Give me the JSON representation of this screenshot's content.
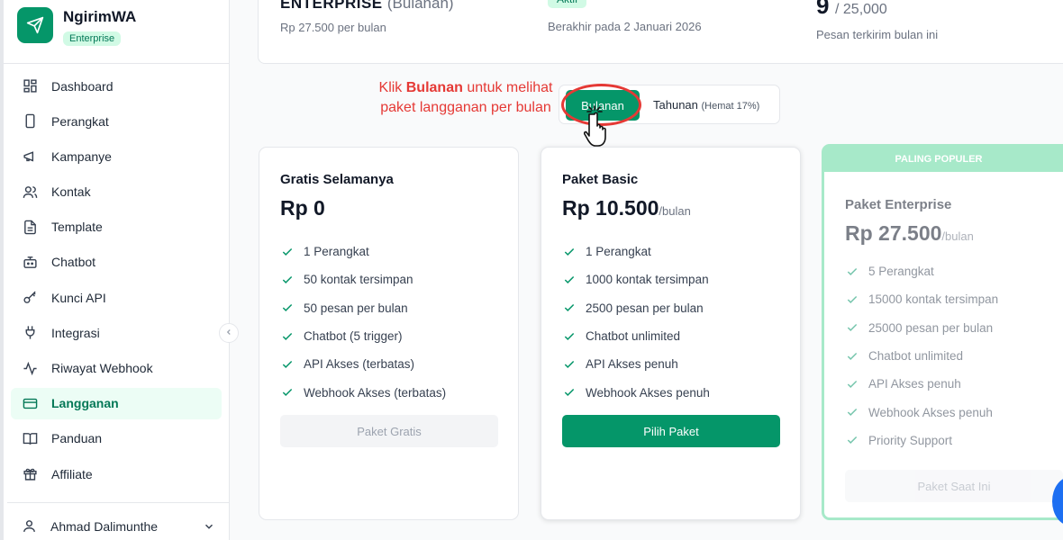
{
  "app": {
    "name": "NgirimWA",
    "tier_badge": "Enterprise"
  },
  "sidebar": {
    "items": [
      {
        "label": "Dashboard",
        "icon": "dashboard-icon"
      },
      {
        "label": "Perangkat",
        "icon": "device-icon"
      },
      {
        "label": "Kampanye",
        "icon": "megaphone-icon"
      },
      {
        "label": "Kontak",
        "icon": "contacts-icon"
      },
      {
        "label": "Template",
        "icon": "document-icon"
      },
      {
        "label": "Chatbot",
        "icon": "bot-icon"
      },
      {
        "label": "Kunci API",
        "icon": "key-icon"
      },
      {
        "label": "Integrasi",
        "icon": "plug-icon"
      },
      {
        "label": "Riwayat Webhook",
        "icon": "activity-icon"
      },
      {
        "label": "Langganan",
        "icon": "credit-card-icon",
        "active": true
      },
      {
        "label": "Panduan",
        "icon": "book-icon"
      },
      {
        "label": "Affiliate",
        "icon": "gift-icon"
      }
    ],
    "user": "Ahmad Dalimunthe"
  },
  "subscription": {
    "plan": "ENTERPRISE",
    "period": "(Bulanan)",
    "price": "Rp 27.500 per bulan",
    "status": "Aktif",
    "expiry": "Berakhir pada 2 Januari 2026",
    "usage_value": "9",
    "usage_total": "/ 25,000",
    "usage_label": "Pesan terkirim bulan ini"
  },
  "billing_toggle": {
    "monthly": "Bulanan",
    "yearly": "Tahunan",
    "yearly_note": "(Hemat 17%)"
  },
  "annotation": {
    "before": "Klik ",
    "bold": "Bulanan",
    "after": " untuk melihat paket langganan per bulan"
  },
  "plans": {
    "free": {
      "name": "Gratis Selamanya",
      "price": "Rp 0",
      "features": [
        "1 Perangkat",
        "50 kontak tersimpan",
        "50 pesan per bulan",
        "Chatbot (5 trigger)",
        "API Akses (terbatas)",
        "Webhook Akses (terbatas)"
      ],
      "button": "Paket Gratis"
    },
    "basic": {
      "name": "Paket Basic",
      "price": "Rp 10.500",
      "per": "/bulan",
      "features": [
        "1 Perangkat",
        "1000 kontak tersimpan",
        "2500 pesan per bulan",
        "Chatbot unlimited",
        "API Akses penuh",
        "Webhook Akses penuh"
      ],
      "button": "Pilih Paket"
    },
    "enterprise": {
      "badge": "PALING POPULER",
      "name": "Paket Enterprise",
      "price": "Rp 27.500",
      "per": "/bulan",
      "features": [
        "5 Perangkat",
        "15000 kontak tersimpan",
        "25000 pesan per bulan",
        "Chatbot unlimited",
        "API Akses penuh",
        "Webhook Akses penuh",
        "Priority Support"
      ],
      "button": "Paket Saat Ini"
    }
  },
  "colors": {
    "accent": "#059669",
    "annotation": "#e53935",
    "popular": "#a7e9c9"
  }
}
